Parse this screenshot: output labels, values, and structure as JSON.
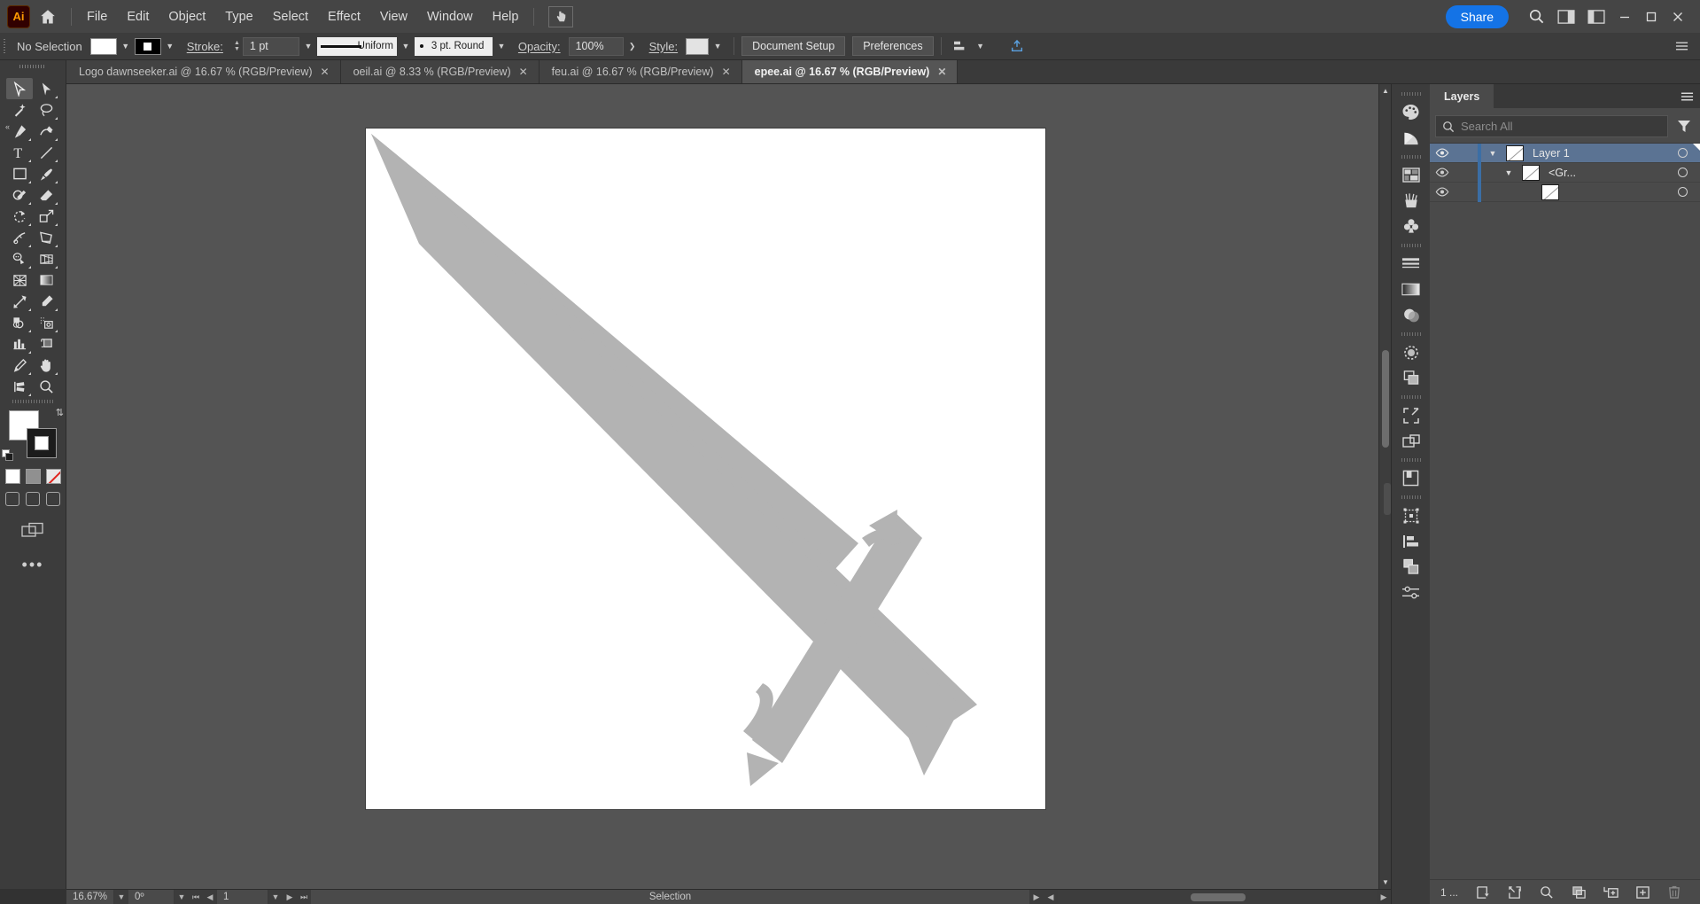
{
  "app": {
    "name": "Adobe Illustrator",
    "logo_text": "Ai",
    "accent_color": "#1473e6",
    "chrome_bg": "#323232"
  },
  "menubar": {
    "items": [
      "File",
      "Edit",
      "Object",
      "Type",
      "Select",
      "Effect",
      "View",
      "Window",
      "Help"
    ],
    "share_label": "Share",
    "icons": [
      "home-icon",
      "cursor-tool-icon",
      "search-icon",
      "arrange-documents-icon",
      "workspace-switcher-icon"
    ],
    "window_controls": [
      "minimize",
      "maximize",
      "close"
    ]
  },
  "controlbar": {
    "selection_state": "No Selection",
    "fill_color": "#ffffff",
    "stroke_color": "#000000",
    "stroke_label": "Stroke:",
    "stroke_weight": "1 pt",
    "stroke_profile": "Uniform",
    "brush_definition": "3 pt. Round",
    "opacity_label": "Opacity:",
    "opacity_value": "100%",
    "style_label": "Style:",
    "style_swatch": "#e3e3e3",
    "document_setup": "Document Setup",
    "preferences": "Preferences"
  },
  "tabs": [
    {
      "label": "Logo dawnseeker.ai @ 16.67 % (RGB/Preview)",
      "active": false
    },
    {
      "label": "oeil.ai @ 8.33 % (RGB/Preview)",
      "active": false
    },
    {
      "label": "feu.ai @ 16.67 % (RGB/Preview)",
      "active": false
    },
    {
      "label": "epee.ai @ 16.67 % (RGB/Preview)",
      "active": true
    }
  ],
  "toolbar": {
    "tools": [
      "selection-tool",
      "direct-selection-tool",
      "magic-wand-tool",
      "lasso-tool",
      "pen-tool",
      "curvature-tool",
      "type-tool",
      "line-segment-tool",
      "rectangle-tool",
      "paintbrush-tool",
      "shaper-tool",
      "eraser-tool",
      "rotate-tool",
      "scale-tool",
      "width-tool",
      "free-transform-tool",
      "shape-builder-tool",
      "perspective-grid-tool",
      "mesh-tool",
      "gradient-tool",
      "blend-tool",
      "eyedropper-tool",
      "symbol-sprayer-tool",
      "slice-tool",
      "column-graph-tool",
      "artboard-tool",
      "pencil-tool",
      "hand-tool",
      "scissors-tool",
      "zoom-tool"
    ],
    "selected_tool": "selection-tool",
    "fill_color": "#ffffff",
    "stroke_color": "#1c1c1c",
    "color_modes": [
      "color-fill",
      "gradient-fill",
      "none-fill"
    ],
    "screen_modes": [
      "normal-screen-mode",
      "full-screen-menu-bar",
      "full-screen-mode"
    ],
    "more_tools_label": "•••"
  },
  "canvas": {
    "artboard_bg": "#ffffff",
    "artwork_name": "sword-illustration",
    "artwork_fill": "#b3b3b3"
  },
  "statusbar": {
    "zoom_level": "16.67%",
    "rotation": "0º",
    "artboard_number": "1",
    "tool_status": "Selection"
  },
  "icon_dock": {
    "icons": [
      "color-panel-icon",
      "color-guide-icon",
      "swatches-panel-icon",
      "brushes-panel-icon",
      "symbols-panel-icon",
      "stroke-panel-icon",
      "gradient-panel-icon",
      "transparency-panel-icon",
      "appearance-panel-icon",
      "pathfinder-panel-icon",
      "asset-export-panel-icon",
      "artboards-panel-icon",
      "libraries-panel-icon",
      "transform-panel-icon",
      "align-panel-icon",
      "layers-panel-icon",
      "properties-panel-icon"
    ]
  },
  "layers_panel": {
    "tab_label": "Layers",
    "menu_icon": "panel-menu-icon",
    "search_placeholder": "Search All",
    "search_value": "",
    "filter_icon": "filter-icon",
    "rows": [
      {
        "name": "Layer 1",
        "selected": true,
        "depth": 0,
        "has_twisty": true,
        "expanded": true,
        "visible": true
      },
      {
        "name": "<Gr...",
        "selected": false,
        "depth": 1,
        "has_twisty": true,
        "expanded": true,
        "visible": true
      },
      {
        "name": "",
        "selected": false,
        "depth": 2,
        "has_twisty": false,
        "expanded": false,
        "visible": true
      }
    ],
    "footer": {
      "count_label": "1 ...",
      "buttons": [
        "locate-object-icon",
        "release-to-layers-icon",
        "search-icon",
        "make-clipping-mask-icon",
        "create-new-sublayer-icon",
        "create-new-layer-icon",
        "delete-selection-icon"
      ]
    }
  }
}
